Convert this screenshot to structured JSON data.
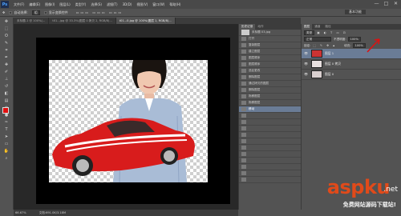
{
  "app": {
    "logo": "Ps"
  },
  "menubar": {
    "items": [
      "文件(F)",
      "编辑(E)",
      "图像(I)",
      "图层(L)",
      "类型(Y)",
      "选择(S)",
      "滤镜(T)",
      "3D(D)",
      "视图(V)",
      "窗口(W)",
      "帮助(H)"
    ],
    "window_controls": [
      "—",
      "□",
      "✕"
    ]
  },
  "workspace": {
    "label": "基本功能"
  },
  "optionsbar": {
    "auto_select": "自动选择:",
    "auto_select_value": "组",
    "show_transform": "显示变换控件"
  },
  "tabs": [
    {
      "label": "未标题-1 @ 100%(..."
    },
    {
      "label": "t01...jpg @ 33.3%(图层 0 拷贝 2, RGB/8)..."
    },
    {
      "label": "t01...0.jpg @ 100%(图层 1, RGB/8)..."
    }
  ],
  "status": {
    "zoom": "66.67%",
    "doc": "文档:691.0K/3.18M"
  },
  "history": {
    "tabs": [
      "历史记录",
      "动作"
    ],
    "snapshot": "未标题 03.jpg",
    "rows": [
      {
        "label": "打开",
        "state": "normal"
      },
      {
        "label": "复制图层",
        "state": "normal"
      },
      {
        "label": "建立图层",
        "state": "normal"
      },
      {
        "label": "图层顺序",
        "state": "normal"
      },
      {
        "label": "图层顺序",
        "state": "normal"
      },
      {
        "label": "选区更改",
        "state": "normal"
      },
      {
        "label": "删除图层",
        "state": "normal"
      },
      {
        "label": "通过拷贝的图层",
        "state": "normal"
      },
      {
        "label": "删除图层",
        "state": "normal"
      },
      {
        "label": "拖移图层",
        "state": "normal"
      },
      {
        "label": "拖移图层",
        "state": "normal"
      },
      {
        "label": "移动",
        "state": "selected"
      },
      {
        "label": "",
        "state": "future"
      },
      {
        "label": "",
        "state": "future"
      },
      {
        "label": "",
        "state": "future"
      },
      {
        "label": "",
        "state": "future"
      },
      {
        "label": "",
        "state": "future"
      },
      {
        "label": "",
        "state": "future"
      },
      {
        "label": "",
        "state": "future"
      },
      {
        "label": "",
        "state": "future"
      },
      {
        "label": "",
        "state": "future"
      },
      {
        "label": "",
        "state": "future"
      },
      {
        "label": "",
        "state": "future"
      }
    ]
  },
  "layers": {
    "tabs": [
      "图层",
      "通道",
      "路径"
    ],
    "filter": "类型",
    "blend_mode": "正常",
    "opacity_label": "不透明度:",
    "opacity_value": "100%",
    "lock_label": "锁定:",
    "fill_label": "填充:",
    "fill_value": "100%",
    "items": [
      {
        "name": "图层 1",
        "selected": true,
        "thumb": "#cc3333"
      },
      {
        "name": "图层 0 拷贝",
        "selected": false,
        "thumb": "#e8e0e0"
      },
      {
        "name": "图层 0",
        "selected": false,
        "thumb": "#d9cfcf"
      }
    ]
  },
  "watermark": {
    "brand": "aspku",
    "suffix": ".net",
    "tagline": "免费网站源码下载站!"
  },
  "colors": {
    "foreground": "#e01010",
    "background": "#ffffff",
    "accent": "#6a7c96"
  }
}
